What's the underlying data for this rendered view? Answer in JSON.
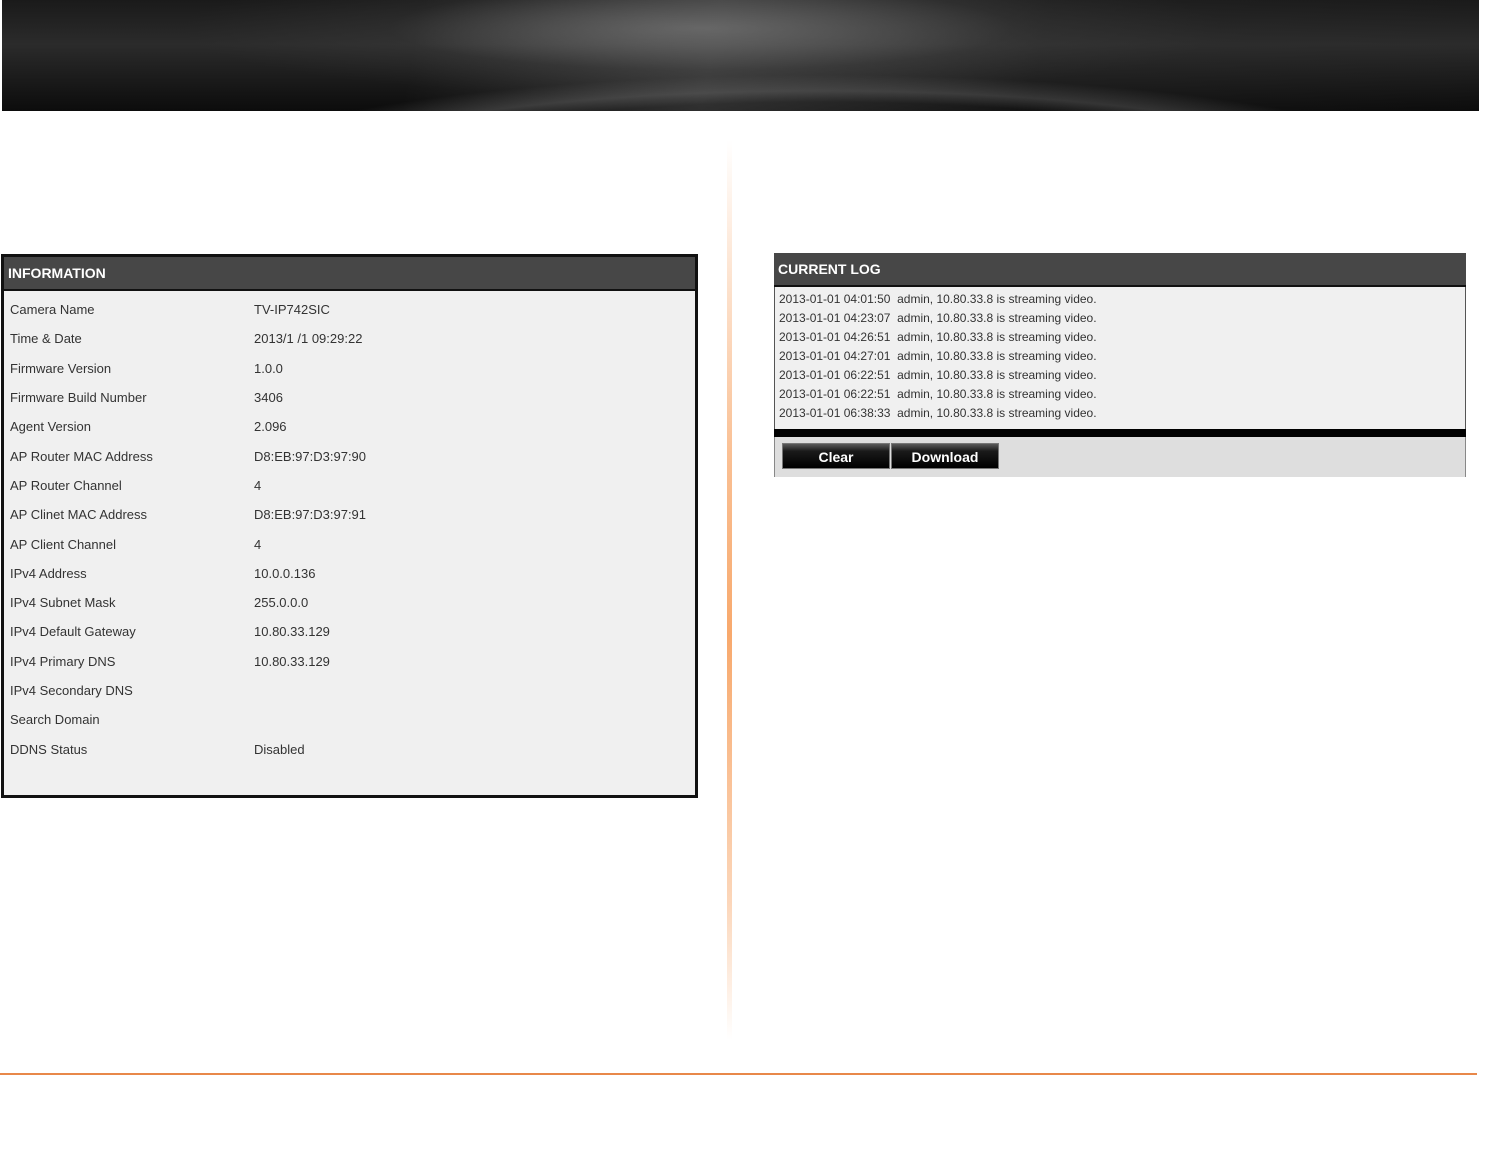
{
  "information": {
    "title": "INFORMATION",
    "rows": [
      {
        "label": "Camera Name",
        "value": "TV-IP742SIC"
      },
      {
        "label": "Time & Date",
        "value": "2013/1 /1 09:29:22"
      },
      {
        "label": "Firmware Version",
        "value": "1.0.0"
      },
      {
        "label": "Firmware Build Number",
        "value": "3406"
      },
      {
        "label": "Agent Version",
        "value": "2.096"
      },
      {
        "label": "AP Router MAC Address",
        "value": "D8:EB:97:D3:97:90"
      },
      {
        "label": "AP Router Channel",
        "value": "4"
      },
      {
        "label": "AP Clinet MAC Address",
        "value": "D8:EB:97:D3:97:91"
      },
      {
        "label": "AP Client Channel",
        "value": "4"
      },
      {
        "label": "IPv4 Address",
        "value": "10.0.0.136"
      },
      {
        "label": "IPv4 Subnet Mask",
        "value": "255.0.0.0"
      },
      {
        "label": "IPv4 Default Gateway",
        "value": "10.80.33.129"
      },
      {
        "label": "IPv4 Primary DNS",
        "value": "10.80.33.129"
      },
      {
        "label": "IPv4 Secondary DNS",
        "value": ""
      },
      {
        "label": "Search Domain",
        "value": ""
      },
      {
        "label": "DDNS Status",
        "value": "Disabled"
      }
    ]
  },
  "log": {
    "title": "CURRENT LOG",
    "entries": [
      "2013-01-01 04:01:50  admin, 10.80.33.8 is streaming video.",
      "2013-01-01 04:23:07  admin, 10.80.33.8 is streaming video.",
      "2013-01-01 04:26:51  admin, 10.80.33.8 is streaming video.",
      "2013-01-01 04:27:01  admin, 10.80.33.8 is streaming video.",
      "2013-01-01 06:22:51  admin, 10.80.33.8 is streaming video.",
      "2013-01-01 06:22:51  admin, 10.80.33.8 is streaming video.",
      "2013-01-01 06:38:33  admin, 10.80.33.8 is streaming video."
    ],
    "clear_label": "Clear",
    "download_label": "Download"
  }
}
